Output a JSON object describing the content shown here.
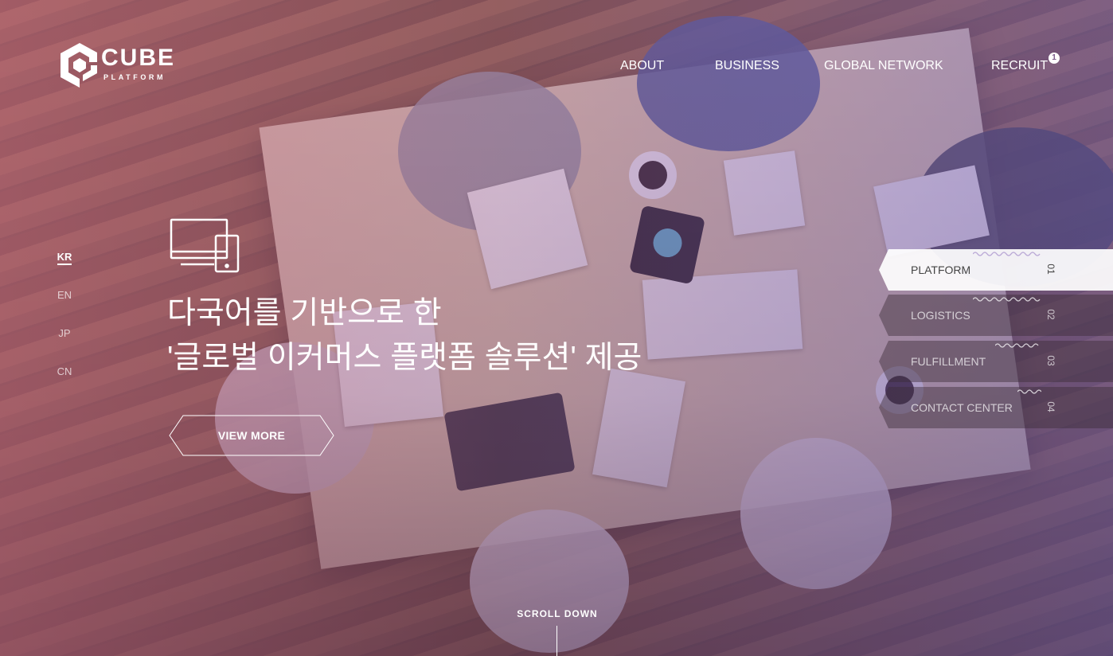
{
  "brand": {
    "logo_main": "CUBE",
    "logo_sub": "PLATFORM"
  },
  "nav": {
    "items": [
      {
        "label": "ABOUT"
      },
      {
        "label": "BUSINESS"
      },
      {
        "label": "GLOBAL NETWORK"
      },
      {
        "label": "RECRUIT",
        "badge": "1"
      }
    ]
  },
  "languages": [
    {
      "label": "KR",
      "active": true
    },
    {
      "label": "EN",
      "active": false
    },
    {
      "label": "JP",
      "active": false
    },
    {
      "label": "CN",
      "active": false
    }
  ],
  "hero": {
    "icon": "devices-icon",
    "headline_line1": "다국어를 기반으로 한",
    "headline_line2": "'글로벌 이커머스 플랫폼 솔루션' 제공",
    "cta_label": "VIEW MORE"
  },
  "services": [
    {
      "label": "PLATFORM",
      "number": "01",
      "active": true
    },
    {
      "label": "LOGISTICS",
      "number": "02",
      "active": false
    },
    {
      "label": "FULFILLMENT",
      "number": "03",
      "active": false
    },
    {
      "label": "CONTACT CENTER",
      "number": "04",
      "active": false
    }
  ],
  "scroll": {
    "label": "SCROLL DOWN"
  },
  "colors": {
    "accent_wave": "#b9a7d6",
    "overlay_left": "#cd6e96",
    "overlay_right": "#7864be"
  }
}
